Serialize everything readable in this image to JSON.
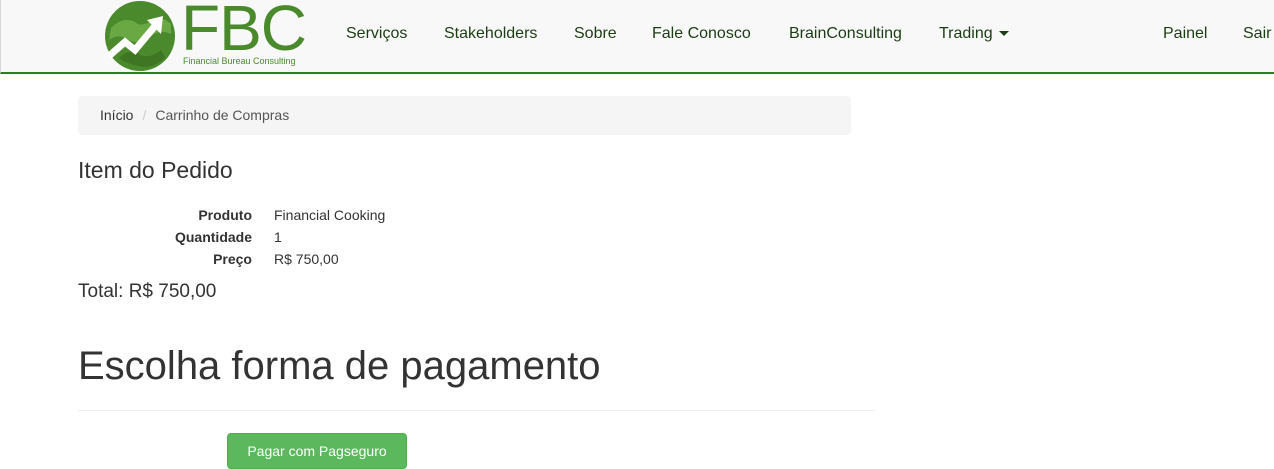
{
  "brand": {
    "letters": "FBC",
    "tagline": "Financial Bureau Consulting",
    "logo_icon": "globe-with-rising-arrow-icon",
    "color": "#4a8a2c"
  },
  "nav": {
    "items": [
      {
        "label": "Serviços"
      },
      {
        "label": "Stakeholders"
      },
      {
        "label": "Sobre"
      },
      {
        "label": "Fale Conosco"
      },
      {
        "label": "BrainConsulting"
      },
      {
        "label": "Trading",
        "has_dropdown": true
      }
    ],
    "right_items": [
      {
        "label": "Painel"
      },
      {
        "label": "Sair"
      }
    ],
    "border_color": "#2f7d1f"
  },
  "breadcrumb": {
    "home": "Início",
    "separator": "/",
    "current": "Carrinho de Compras"
  },
  "order": {
    "title": "Item do Pedido",
    "fields": [
      {
        "label": "Produto",
        "value": "Financial Cooking"
      },
      {
        "label": "Quantidade",
        "value": "1"
      },
      {
        "label": "Preço",
        "value": "R$ 750,00"
      }
    ],
    "total": "Total: R$ 750,00"
  },
  "payment": {
    "heading": "Escolha forma de pagamento",
    "button_label": "Pagar com Pagseguro",
    "button_color": "#5cb85c"
  }
}
